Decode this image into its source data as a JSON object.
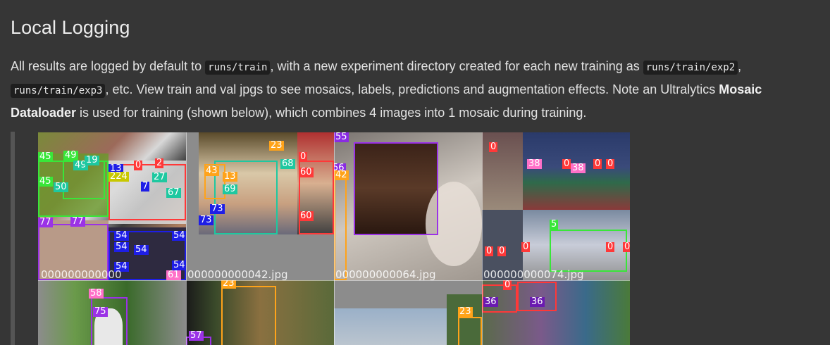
{
  "heading": "Local Logging",
  "paragraph": {
    "t1": "All results are logged by default to ",
    "c1": "runs/train",
    "t2": ", with a new experiment directory created for each new training as ",
    "c2": "runs/train/exp2",
    "t3": ", ",
    "c3": "runs/train/exp3",
    "t4": ", etc. View train and val jpgs to see mosaics, labels, predictions and augmentation effects. Note an Ultralytics ",
    "b1": "Mosaic Dataloader",
    "t5": " is used for training (shown below), which combines 4 images into 1 mosaic during training."
  },
  "mosaic": {
    "tile_labels": [
      "000000000000",
      "000000000042.jpg",
      "000000000064.jpg",
      "000000000074.jpg"
    ],
    "class_labels": [
      "45",
      "49",
      "49",
      "19",
      "45",
      "50",
      "13",
      "224",
      "0",
      "2",
      "7",
      "27",
      "67",
      "77",
      "77",
      "54",
      "54",
      "54",
      "54",
      "54",
      "54",
      "61",
      "23",
      "43",
      "13",
      "68",
      "69",
      "73",
      "73",
      "0",
      "60",
      "56",
      "42",
      "60",
      "55",
      "0",
      "38",
      "0",
      "38",
      "0",
      "0",
      "5",
      "0",
      "0",
      "0",
      "0",
      "0",
      "58",
      "75",
      "57",
      "23",
      "23",
      "36",
      "36",
      "0"
    ],
    "colors": {
      "green": "#39e639",
      "red": "#ff3838",
      "blue": "#1e1ee6",
      "yellow": "#c8c800",
      "orange": "#ffa31a",
      "purple": "#9b32e6",
      "pink": "#ff70c8",
      "teal": "#1ec8a0",
      "violet": "#8a2be2"
    }
  }
}
